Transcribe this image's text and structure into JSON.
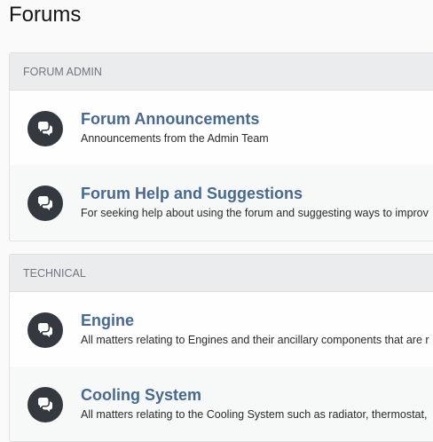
{
  "page": {
    "title": "Forums"
  },
  "categories": [
    {
      "name": "FORUM ADMIN",
      "nodes": [
        {
          "title": "Forum Announcements",
          "description": "Announcements from the Admin Team",
          "icon": "chat-bubbles-icon"
        },
        {
          "title": "Forum Help and Suggestions",
          "description": "For seeking help about using the forum and suggesting ways to improv",
          "icon": "chat-bubbles-icon"
        }
      ]
    },
    {
      "name": "TECHNICAL",
      "nodes": [
        {
          "title": "Engine",
          "description": "All matters relating to Engines and their ancillary components that are r",
          "icon": "chat-bubbles-icon"
        },
        {
          "title": "Cooling System",
          "description": "All matters relating to the Cooling System such as radiator, thermostat,",
          "icon": "chat-bubbles-icon"
        }
      ]
    }
  ],
  "colors": {
    "node_title": "#47698f",
    "icon_circle": "#34393f",
    "header_bg": "#ebecee",
    "header_text": "#6e7680"
  }
}
